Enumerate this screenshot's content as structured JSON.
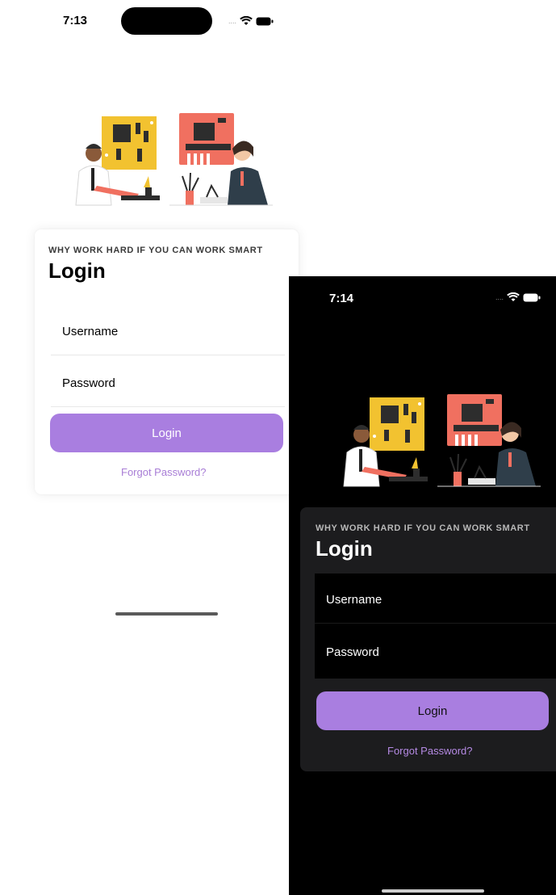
{
  "light_screen": {
    "status_bar": {
      "time": "7:13",
      "signal": "....",
      "icons": [
        "wifi-icon",
        "battery-icon"
      ]
    },
    "illustration": "engineers-circuit-board-illustration",
    "card": {
      "subtitle": "WHY WORK HARD IF YOU CAN WORK SMART",
      "title": "Login",
      "username": {
        "placeholder": "Username",
        "value": ""
      },
      "password": {
        "placeholder": "Password",
        "value": ""
      },
      "login_button": "Login",
      "forgot_link": "Forgot Password?"
    }
  },
  "dark_screen": {
    "status_bar": {
      "time": "7:14",
      "signal": "....",
      "icons": [
        "wifi-icon",
        "battery-icon"
      ]
    },
    "illustration": "engineers-circuit-board-illustration",
    "card": {
      "subtitle": "WHY WORK HARD IF YOU CAN WORK SMART",
      "title": "Login",
      "username": {
        "placeholder": "Username",
        "value": ""
      },
      "password": {
        "placeholder": "Password",
        "value": ""
      },
      "login_button": "Login",
      "forgot_link": "Forgot Password?"
    }
  },
  "colors": {
    "accent": "#a97ee0",
    "link": "#a87dd6",
    "dark_card": "#1c1c1e",
    "dark_background": "#000000",
    "light_background": "#ffffff"
  }
}
